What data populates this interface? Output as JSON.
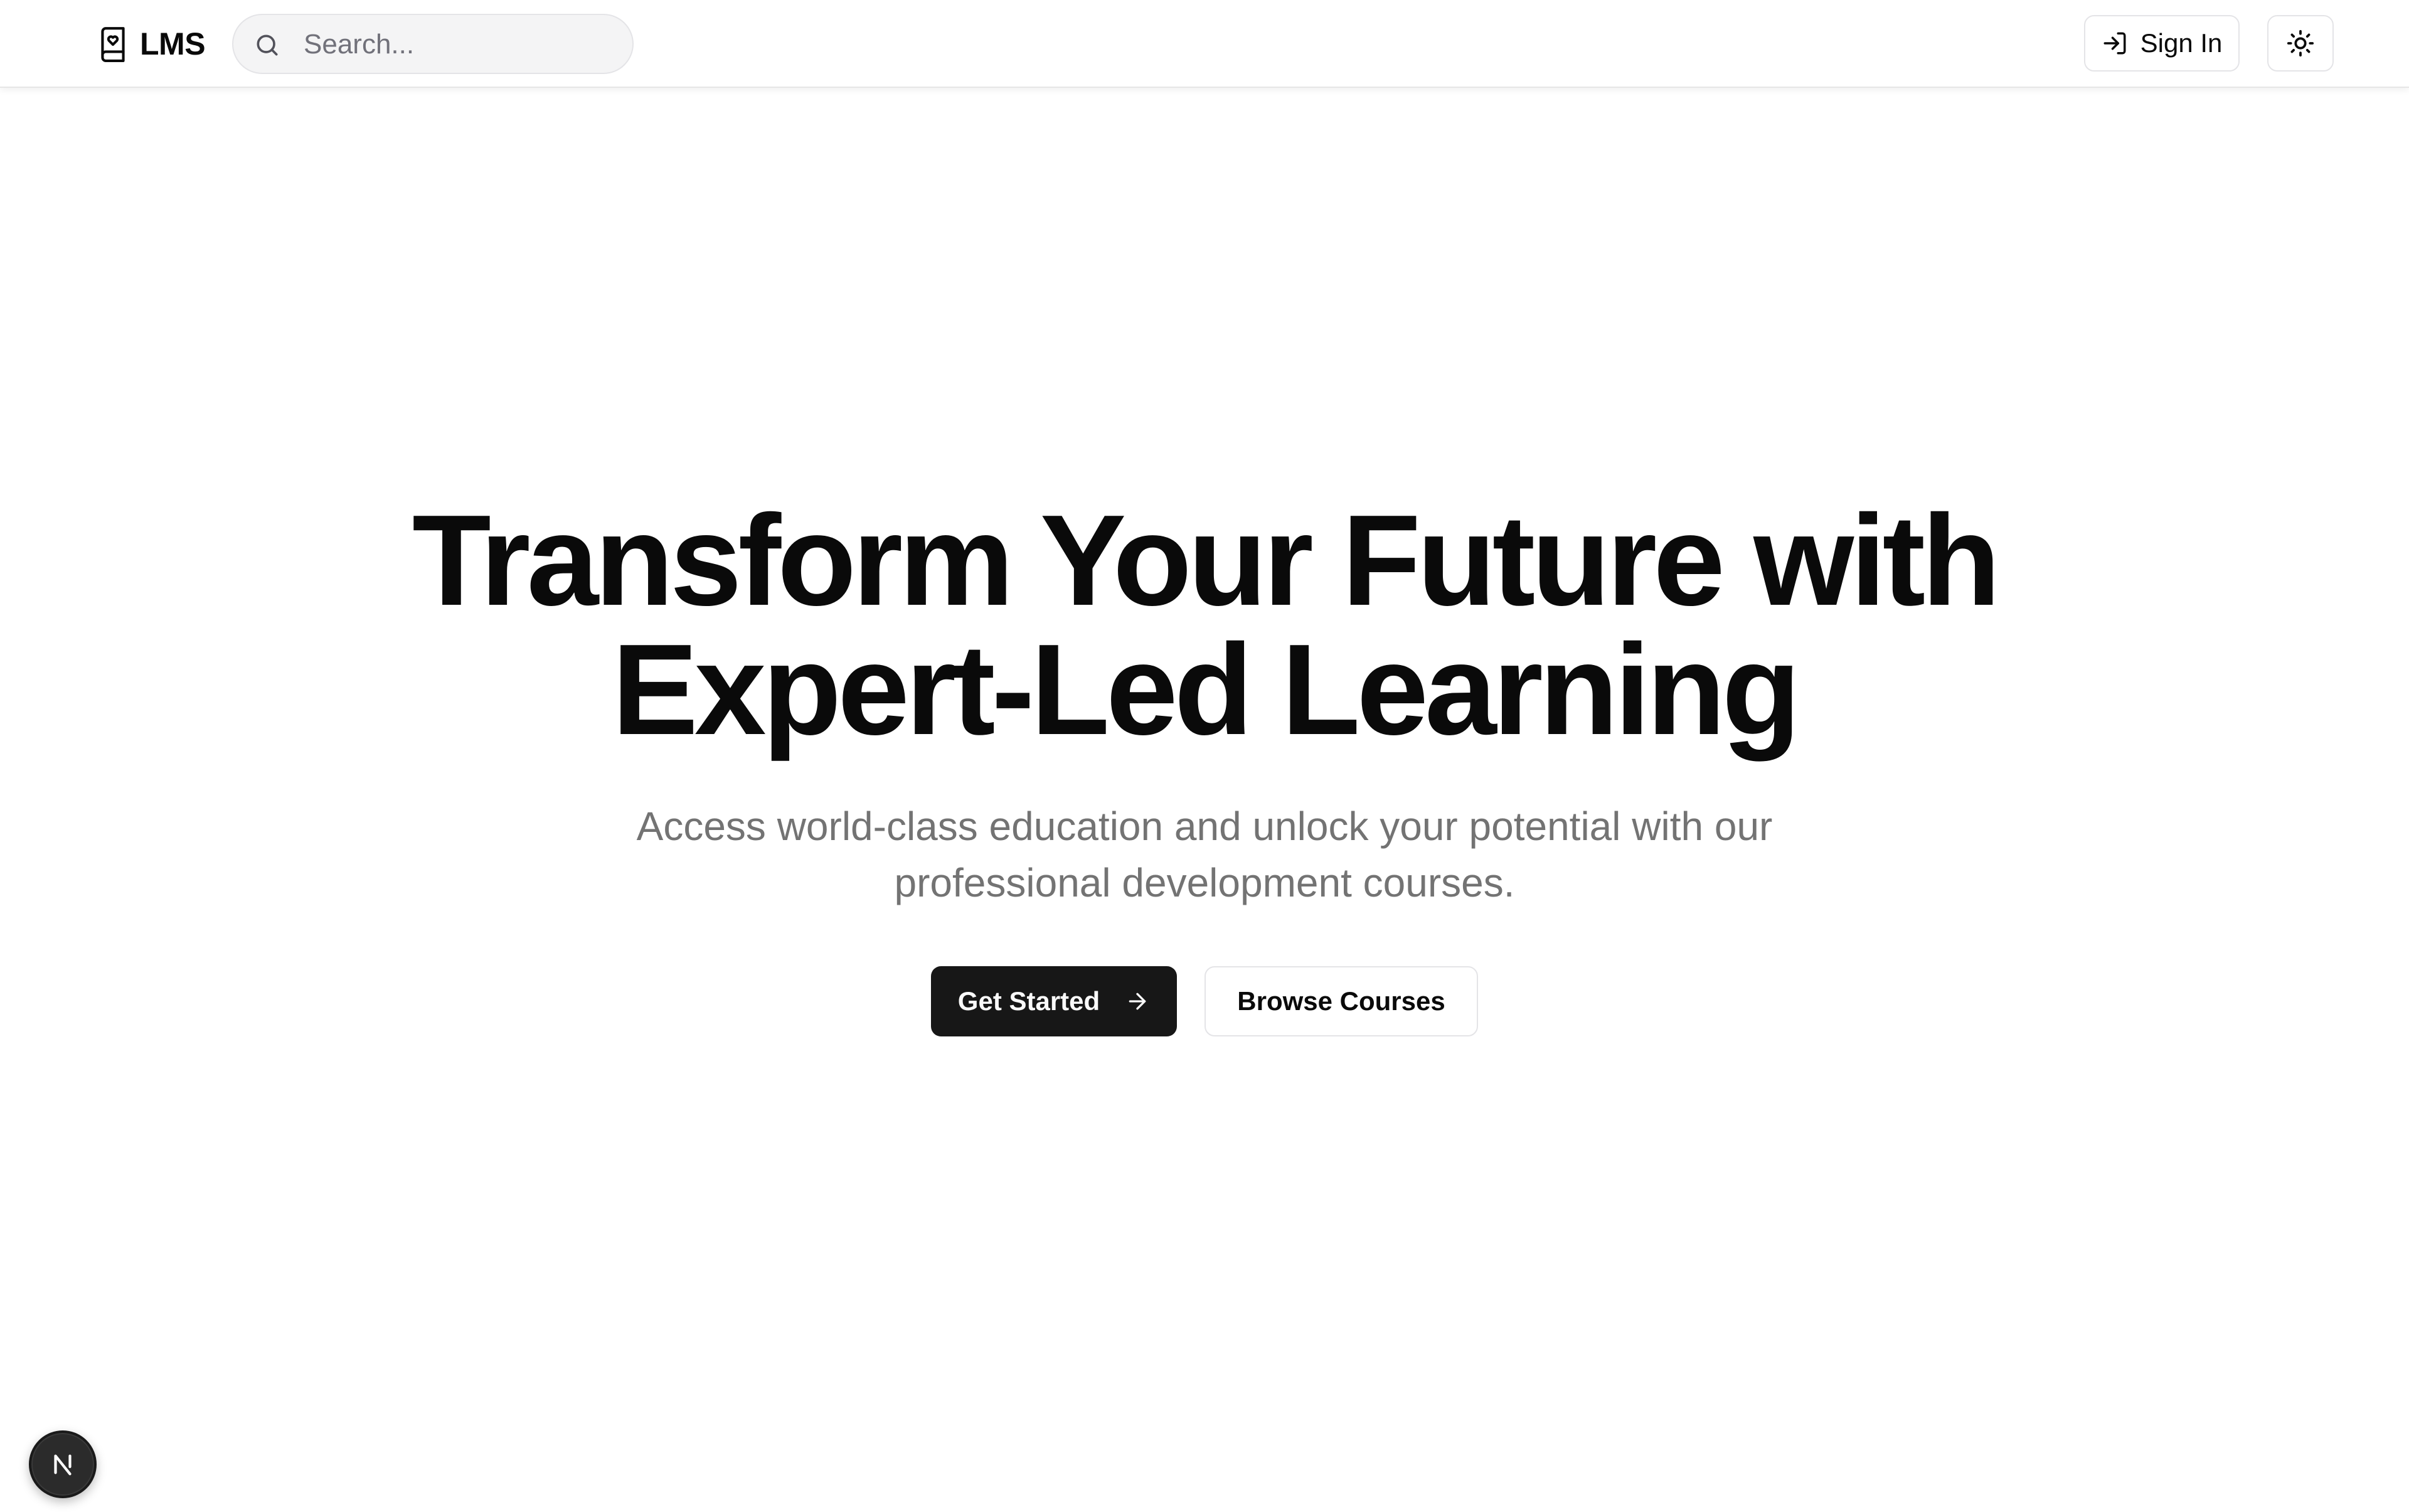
{
  "header": {
    "brand_name": "LMS",
    "brand_icon": "book-heart-icon",
    "search": {
      "placeholder": "Search...",
      "value": "",
      "icon": "search-icon"
    },
    "sign_in_label": "Sign In",
    "sign_in_icon": "log-in-icon",
    "theme_toggle_icon": "sun-icon"
  },
  "hero": {
    "title_line1": "Transform Your Future with",
    "title_line2": "Expert-Led Learning",
    "subtitle_line1": "Access world-class education and unlock your potential with our",
    "subtitle_line2": "professional development courses.",
    "primary_cta_label": "Get Started",
    "primary_cta_icon": "arrow-right-icon",
    "secondary_cta_label": "Browse Courses"
  },
  "dev_indicator": {
    "icon": "nextjs-n-icon"
  },
  "colors": {
    "background": "#ffffff",
    "text": "#0a0a0a",
    "muted_text": "#737373",
    "primary_button": "#171717",
    "border": "#e4e4e7"
  }
}
